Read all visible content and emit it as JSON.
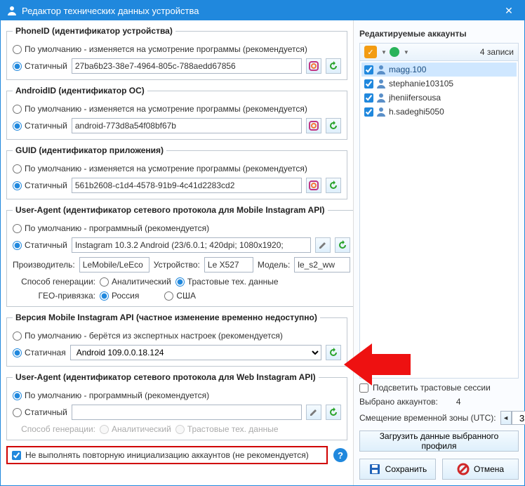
{
  "title": "Редактор технических данных устройства",
  "sections": {
    "phoneid": {
      "legend": "PhoneID (идентификатор устройства)",
      "default_label": "По умолчанию - изменяется на усмотрение программы (рекомендуется)",
      "static_label": "Статичный",
      "value": "27ba6b23-38e7-4964-805c-788aedd67856"
    },
    "androidid": {
      "legend": "AndroidID (идентификатор ОС)",
      "default_label": "По умолчанию - изменяется на усмотрение программы (рекомендуется)",
      "static_label": "Статичный",
      "value": "android-773d8a54f08bf67b"
    },
    "guid": {
      "legend": "GUID (идентификатор приложения)",
      "default_label": "По умолчанию - изменяется на усмотрение программы (рекомендуется)",
      "static_label": "Статичный",
      "value": "561b2608-c1d4-4578-91b9-4c41d2283cd2"
    },
    "ua_mobile": {
      "legend": "User-Agent (идентификатор сетевого протокола для Mobile Instagram API)",
      "default_label": "По умолчанию - программный (рекомендуется)",
      "static_label": "Статичный",
      "value": "Instagram 10.3.2 Android (23/6.0.1; 420dpi; 1080x1920;",
      "manufacturer_label": "Производитель:",
      "manufacturer": "LeMobile/LeEco",
      "device_label": "Устройство:",
      "device": "Le X527",
      "model_label": "Модель:",
      "model": "le_s2_ww",
      "genmode_label": "Способ генерации:",
      "gen_analytical": "Аналитический",
      "gen_trust": "Трастовые тех. данные",
      "geo_label": "ГЕО-привязка:",
      "geo_russia": "Россия",
      "geo_usa": "США"
    },
    "api_version": {
      "legend": "Версия Mobile Instagram API (частное изменение временно недоступно)",
      "default_label": "По умолчанию - берётся из экспертных настроек (рекомендуется)",
      "static_label": "Статичная",
      "value": "Android 109.0.0.18.124"
    },
    "ua_web": {
      "legend": "User-Agent (идентификатор сетевого протокола для Web Instagram API)",
      "default_label": "По умолчанию - программный (рекомендуется)",
      "static_label": "Статичный",
      "value": "",
      "genmode_label": "Способ генерации:",
      "gen_analytical": "Аналитический",
      "gen_trust": "Трастовые тех. данные"
    }
  },
  "noreinit_label": "Не выполнять повторную инициализацию аккаунтов (не рекомендуется)",
  "right": {
    "header": "Редактируемые аккаунты",
    "count": "4 записи",
    "accounts": [
      "magg.100",
      "stephanie103105",
      "jheniifersousa",
      "h.sadeghi5050"
    ],
    "highlight_label": "Подсветить трастовые сессии",
    "selected_label": "Выбрано аккаунтов:",
    "selected_value": "4",
    "tz_label": "Смещение временной зоны (UTC):",
    "tz_value": "3",
    "load_button": "Загрузить данные выбранного профиля",
    "save": "Сохранить",
    "cancel": "Отмена"
  }
}
